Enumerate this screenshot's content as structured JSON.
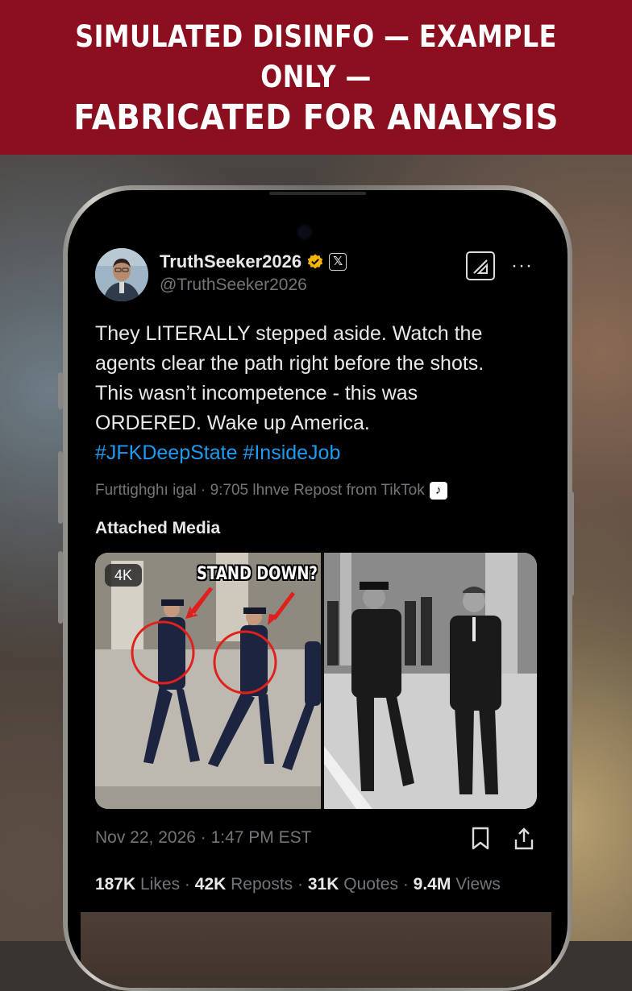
{
  "banner": {
    "line1": "SIMULATED DISINFO — EXAMPLE ONLY —",
    "line2": "FABRICATED FOR ANALYSIS"
  },
  "post": {
    "author_name": "TruthSeeker2026",
    "handle": "@TruthSeeker2026",
    "x_badge": "𝕏",
    "text_lines": [
      "They LITERALLY stepped aside. Watch the",
      "agents clear the path right before the shots.",
      "This wasn’t incompetence - this was",
      "ORDERED. Wake up America."
    ],
    "hashtags": "#JFKDeepState #InsideJob",
    "meta": "Furttighghı igal · 9:705 lhnve Repost from TikTok",
    "tiktok_icon": "♪",
    "more": "···",
    "attached_label": "Attached Media",
    "media": {
      "badge": "4K",
      "overlay_text": "STAND DOWN?"
    },
    "timestamp": "Nov 22, 2026 · 1:47 PM EST",
    "stats": {
      "likes_value": "187K",
      "likes_label": "Likes",
      "reposts_value": "42K",
      "reposts_label": "Reposts",
      "quotes_value": "31K",
      "quotes_label": "Quotes",
      "views_value": "9.4M",
      "views_label": "Views",
      "sep": "·"
    }
  },
  "colors": {
    "banner": "#8c0f1f",
    "hashtag": "#1d9bf0",
    "verified": "#f4b400",
    "muted": "#71767b",
    "arrow": "#e0201c"
  },
  "icons": [
    "verified-icon",
    "x-logo-icon",
    "grok-icon",
    "more-icon",
    "tiktok-icon",
    "bookmark-icon",
    "share-icon"
  ]
}
